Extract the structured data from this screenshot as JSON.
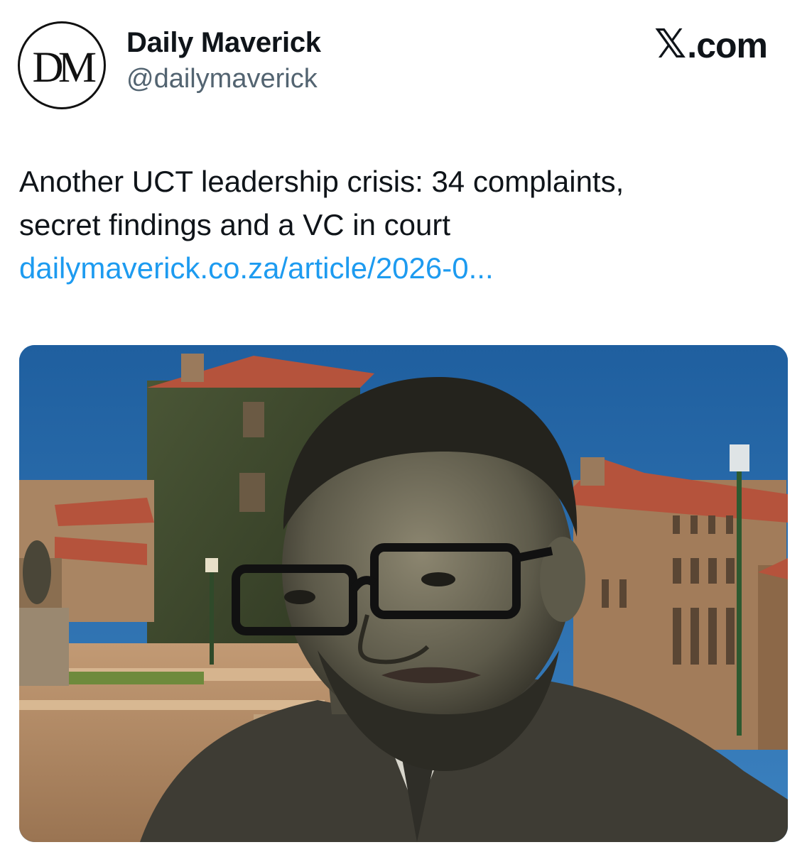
{
  "account": {
    "name": "Daily Maverick",
    "handle": "@dailymaverick",
    "avatar_monogram": "DM"
  },
  "source": {
    "logo_icon": "x-logo-icon",
    "label": ".com"
  },
  "tweet": {
    "text_lines": [
      "Another UCT leadership crisis: 34 complaints,",
      "secret findings and a VC in court"
    ],
    "link": "dailymaverick.co.za/article/2026-0..."
  },
  "media": {
    "icon": "article-photo",
    "description_colors": {
      "sky": "#2f74b5",
      "roof": "#b5533c",
      "stone": "#b08a66",
      "ivy": "#3c4a2c",
      "portrait": "#6e6a5a"
    }
  },
  "colors": {
    "link": "#1d9bf0",
    "handle": "#536471",
    "text": "#0f1419"
  }
}
